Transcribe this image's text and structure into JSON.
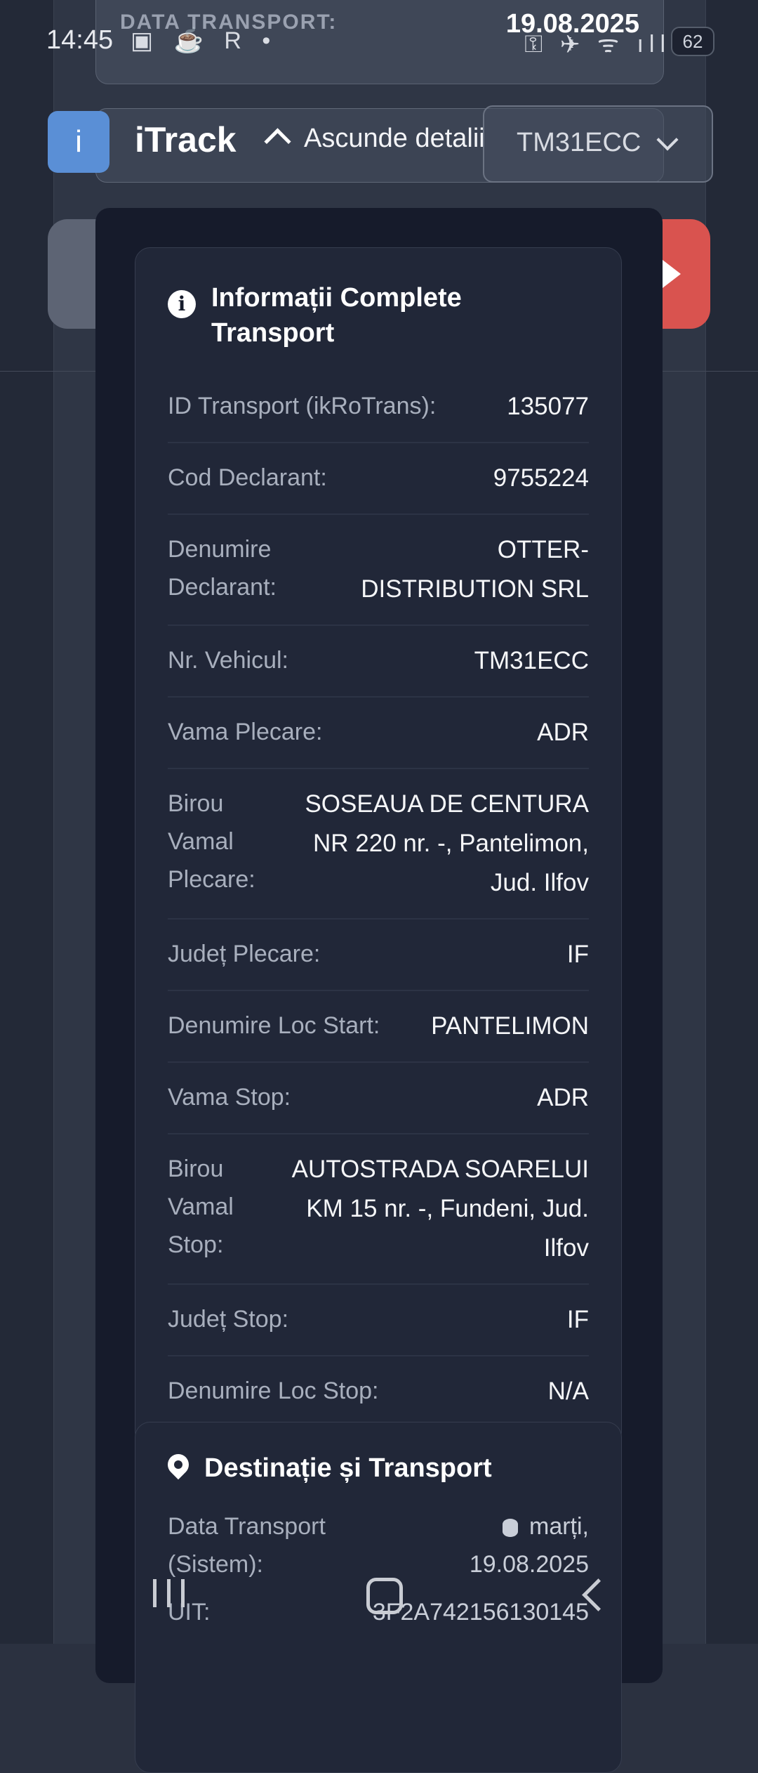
{
  "status_bar": {
    "time": "14:45",
    "left_icons": "▣ ☕ R •",
    "right_icons": "⚿ ✈ ᯤ ıll",
    "battery": "62"
  },
  "transport_date": {
    "label": "DATA TRANSPORT:",
    "value": "19.08.2025"
  },
  "header": {
    "logo_letter": "i",
    "app_title": "iTrack",
    "toggle_label": "Ascunde detalii",
    "vehicle_selected": "TM31ECC"
  },
  "info_card": {
    "title": "Informații Complete Transport",
    "rows": [
      {
        "label": "ID Transport (ikRoTrans):",
        "value": "135077"
      },
      {
        "label": "Cod Declarant:",
        "value": "9755224"
      },
      {
        "label": "Denumire Declarant:",
        "value": "OTTER-DISTRIBUTION SRL"
      },
      {
        "label": "Nr. Vehicul:",
        "value": "TM31ECC"
      },
      {
        "label": "Vama Plecare:",
        "value": "ADR"
      },
      {
        "label": "Birou Vamal Plecare:",
        "value": "SOSEAUA DE CENTURA NR 220 nr. -, Pantelimon, Jud. Ilfov"
      },
      {
        "label": "Județ Plecare:",
        "value": "IF"
      },
      {
        "label": "Denumire Loc Start:",
        "value": "PANTELIMON"
      },
      {
        "label": "Vama Stop:",
        "value": "ADR"
      },
      {
        "label": "Birou Vamal Stop:",
        "value": "AUTOSTRADA SOARELUI KM 15 nr. -, Fundeni, Jud. Ilfov"
      },
      {
        "label": "Județ Stop:",
        "value": "IF"
      },
      {
        "label": "Denumire Loc Stop:",
        "value": "N/A"
      }
    ]
  },
  "dest_card": {
    "title": "Destinație și Transport",
    "date_label": "Data Transport (Sistem):",
    "date_value": "marți, 19.08.2025",
    "uit_label": "UIT:",
    "uit_value": "3F2A742156130145"
  }
}
